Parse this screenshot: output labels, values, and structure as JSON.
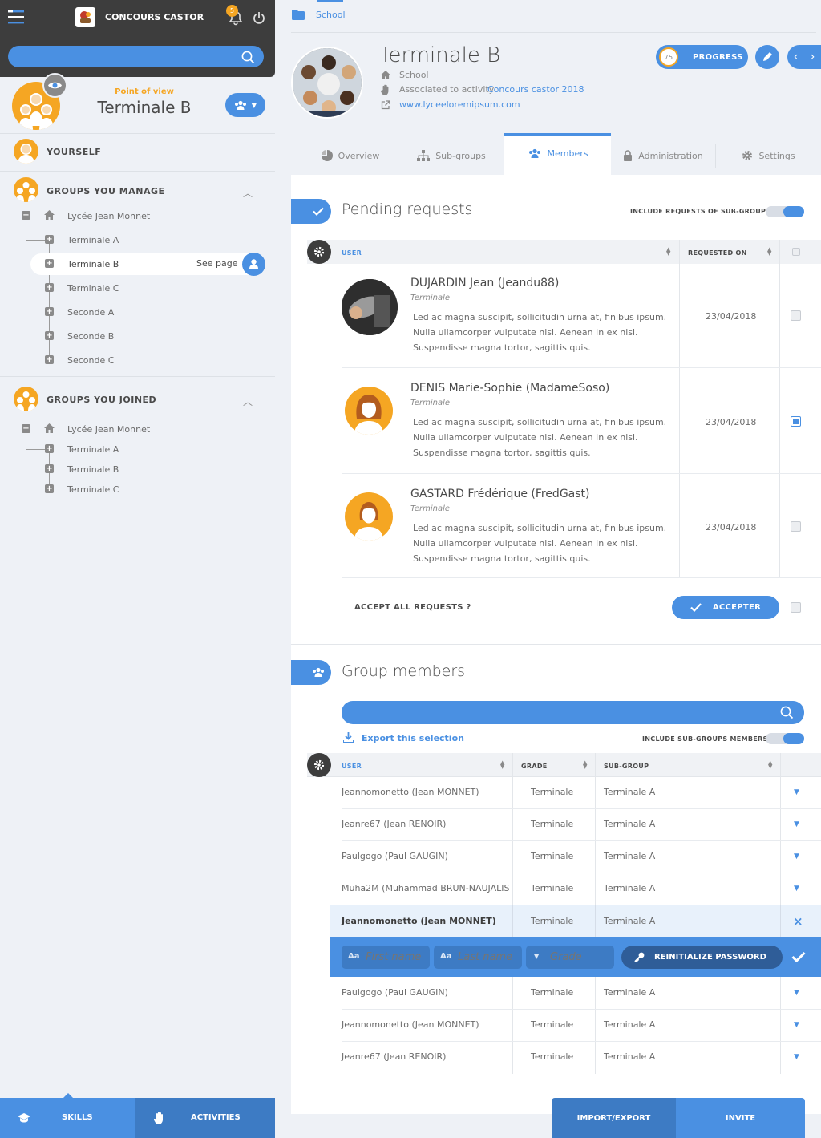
{
  "app": {
    "title": "CONCOURS CASTOR",
    "notifications": "5"
  },
  "sidebar": {
    "search_placeholder": "",
    "point_of_view_label": "Point of view",
    "point_of_view_value": "Terminale B",
    "yourself": "YOURSELF",
    "groups_manage": {
      "title": "GROUPS YOU MANAGE",
      "items": [
        "Lycée Jean Monnet",
        "Terminale A",
        "Terminale B",
        "Terminale C",
        "Seconde A",
        "Seconde B",
        "Seconde C"
      ],
      "selected_action": "See page"
    },
    "groups_joined": {
      "title": "GROUPS YOU JOINED",
      "items": [
        "Lycée Jean Monnet",
        "Terminale A",
        "Terminale B",
        "Terminale C"
      ]
    },
    "bottom": {
      "skills": "SKILLS",
      "activities": "ACTIVITIES"
    }
  },
  "breadcrumb": {
    "item": "School"
  },
  "group": {
    "name": "Terminale B",
    "type": "School",
    "activity_prefix": "Associated to activity",
    "activity_link": "Concours castor 2018",
    "website": "www.lyceeloremipsum.com",
    "progress_value": "75",
    "progress_label": "PROGRESS"
  },
  "tabs": [
    "Overview",
    "Sub-groups",
    "Members",
    "Administration",
    "Settings"
  ],
  "pending": {
    "title": "Pending requests",
    "include_label": "INCLUDE REQUESTS OF SUB-GROUPS",
    "columns": {
      "user": "USER",
      "requested_on": "REQUESTED ON"
    },
    "rows": [
      {
        "name": "DUJARDIN Jean (Jeandu88)",
        "grade": "Terminale",
        "message": [
          "Led ac magna suscipit, sollicitudin urna at, finibus ipsum.",
          "Nulla ullamcorper vulputate nisl. Aenean in ex nisl.",
          "Suspendisse magna tortor, sagittis quis."
        ],
        "date": "23/04/2018",
        "checked": false
      },
      {
        "name": "DENIS Marie-Sophie (MadameSoso)",
        "grade": "Terminale",
        "message": [
          "Led ac magna suscipit, sollicitudin urna at, finibus ipsum.",
          "Nulla ullamcorper vulputate nisl. Aenean in ex nisl.",
          "Suspendisse magna tortor, sagittis quis."
        ],
        "date": "23/04/2018",
        "checked": true
      },
      {
        "name": "GASTARD Frédérique (FredGast)",
        "grade": "Terminale",
        "message": [
          "Led ac magna suscipit, sollicitudin urna at, finibus ipsum.",
          "Nulla ullamcorper vulputate nisl. Aenean in ex nisl.",
          "Suspendisse magna tortor, sagittis quis."
        ],
        "date": "23/04/2018",
        "checked": false
      }
    ],
    "accept_all_label": "ACCEPT ALL REQUESTS ?",
    "accept_button": "ACCEPTER"
  },
  "members": {
    "title": "Group members",
    "search_placeholder": "",
    "export_label": "Export this selection",
    "include_label": "INCLUDE SUB-GROUPS MEMBERS",
    "columns": {
      "user": "USER",
      "grade": "GRADE",
      "subgroup": "SUB-GROUP"
    },
    "rows": [
      {
        "user": "Jeannomonetto (Jean MONNET)",
        "grade": "Terminale",
        "subgroup": "Terminale A"
      },
      {
        "user": "Jeanre67 (Jean RENOIR)",
        "grade": "Terminale",
        "subgroup": "Terminale A"
      },
      {
        "user": "Paulgogo (Paul GAUGIN)",
        "grade": "Terminale",
        "subgroup": "Terminale A"
      },
      {
        "user": "Muha2M (Muhammad BRUN-NAUJALIS",
        "grade": "Terminale",
        "subgroup": "Terminale A"
      },
      {
        "user": "Jeannomonetto (Jean MONNET)",
        "grade": "Terminale",
        "subgroup": "Terminale A"
      },
      {
        "user": "Paulgogo (Paul GAUGIN)",
        "grade": "Terminale",
        "subgroup": "Terminale A"
      },
      {
        "user": "Jeannomonetto (Jean MONNET)",
        "grade": "Terminale",
        "subgroup": "Terminale A"
      },
      {
        "user": "Jeanre67 (Jean RENOIR)",
        "grade": "Terminale",
        "subgroup": "Terminale A"
      }
    ],
    "edit": {
      "aa": "Aa",
      "first_name_placeholder": "First name",
      "last_name_placeholder": "Last name",
      "grade_placeholder": "Grade",
      "reset_button": "REINITIALIZE PASSWORD"
    }
  },
  "footer": {
    "import_export": "IMPORT/EXPORT",
    "invite": "INVITE"
  }
}
